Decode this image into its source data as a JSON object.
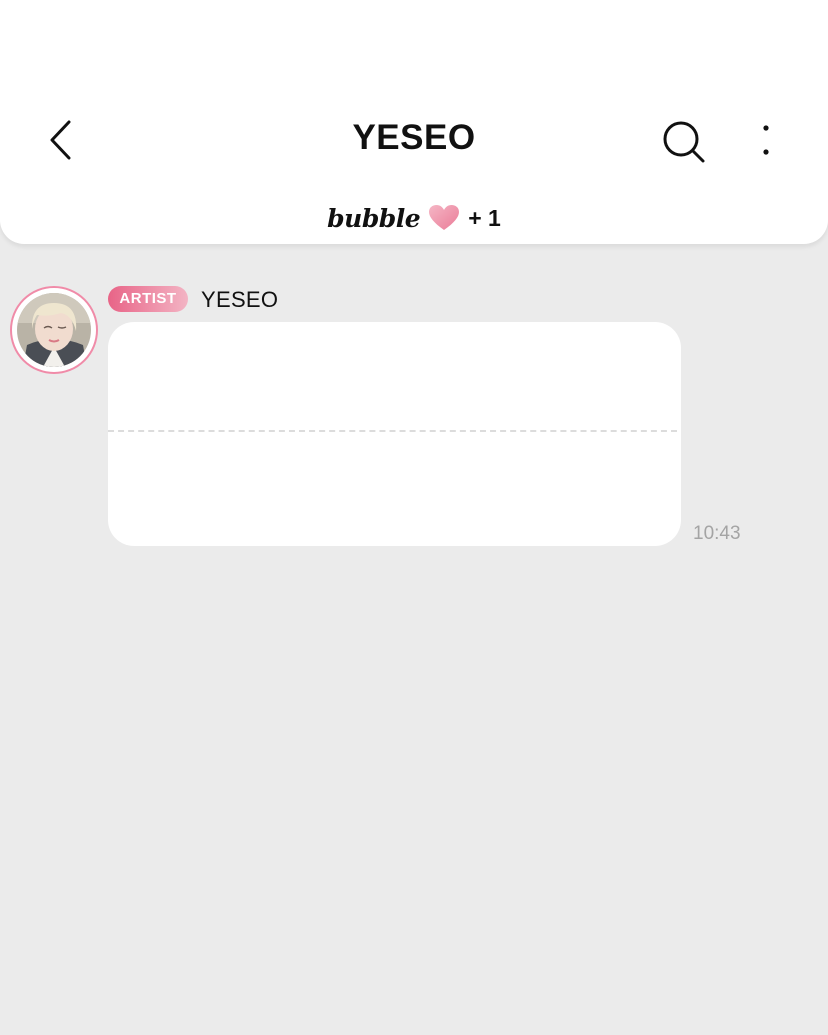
{
  "header": {
    "title": "YESEO",
    "bubble_logo": "bubble",
    "bubble_count": "+ 1",
    "back_icon": "chevron-left-icon",
    "search_icon": "search-icon",
    "more_icon": "vertical-ellipsis-icon"
  },
  "message": {
    "badge": "ARTIST",
    "sender": "YESEO",
    "timestamp": "10:43"
  },
  "colors": {
    "background": "#ebebeb",
    "header_background": "#ffffff",
    "accent_pink": "#e86487",
    "avatar_ring": "#f08ba8",
    "timestamp": "#a4a4a4"
  }
}
